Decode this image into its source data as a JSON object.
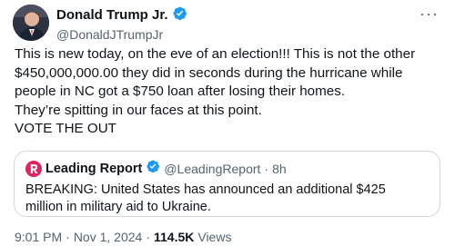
{
  "author": {
    "name": "Donald Trump Jr.",
    "handle": "@DonaldJTrumpJr",
    "more_label": "···"
  },
  "tweet": {
    "lines": [
      "This is new today, on the eve of an election!!! This is not the other $450,000,000.00 they did in seconds during the hurricane while people in NC got a $750 loan after losing their homes.",
      "They’re spitting in our faces at this point.",
      "VOTE THE OUT"
    ]
  },
  "quote": {
    "name": "Leading Report",
    "handle": "@LeadingReport",
    "separator": "·",
    "time": "8h",
    "text": "BREAKING: United States has announced an additional $425 million in military aid to Ukraine."
  },
  "footer": {
    "time": "9:01 PM",
    "sep1": "·",
    "date": "Nov 1, 2024",
    "sep2": "·",
    "views_count": "114.5K",
    "views_label": "Views"
  },
  "colors": {
    "verified": "#1d9bf0",
    "secondary_text": "#536471",
    "brand_logo": "#e0245e"
  }
}
